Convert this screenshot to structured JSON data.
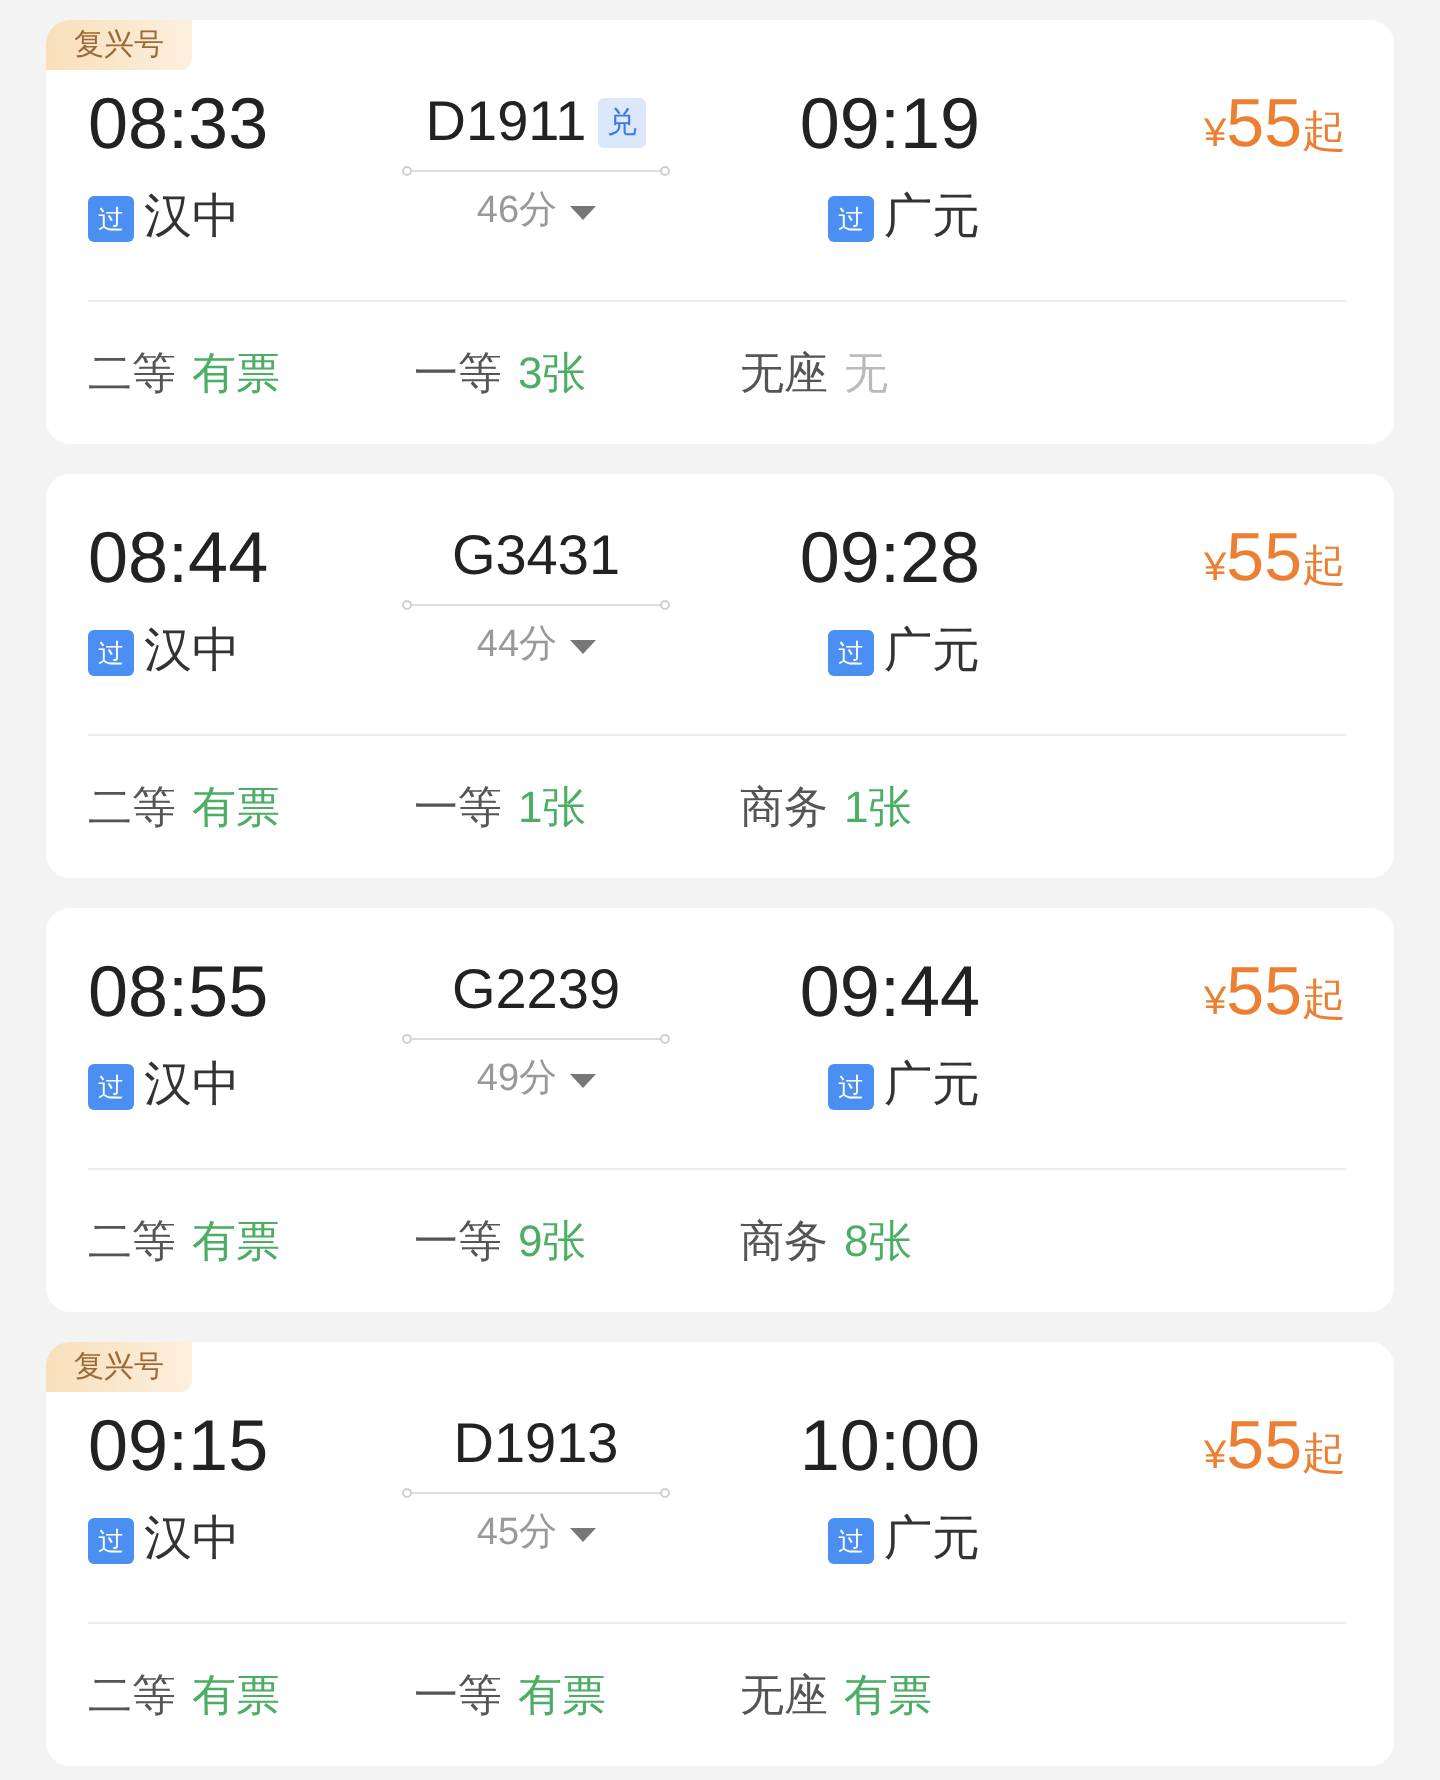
{
  "trains": [
    {
      "badge": "复兴号",
      "depart_time": "08:33",
      "depart_tag": "过",
      "depart_station": "汉中",
      "train_no": "D1911",
      "train_tag": "兑",
      "duration": "46分",
      "arrive_time": "09:19",
      "arrive_tag": "过",
      "arrive_station": "广元",
      "price_symbol": "¥",
      "price": "55",
      "price_suffix": "起",
      "seats": [
        {
          "class": "二等",
          "availability": "有票",
          "available": true
        },
        {
          "class": "一等",
          "availability": "3张",
          "available": true
        },
        {
          "class": "无座",
          "availability": "无",
          "available": false
        }
      ]
    },
    {
      "depart_time": "08:44",
      "depart_tag": "过",
      "depart_station": "汉中",
      "train_no": "G3431",
      "duration": "44分",
      "arrive_time": "09:28",
      "arrive_tag": "过",
      "arrive_station": "广元",
      "price_symbol": "¥",
      "price": "55",
      "price_suffix": "起",
      "seats": [
        {
          "class": "二等",
          "availability": "有票",
          "available": true
        },
        {
          "class": "一等",
          "availability": "1张",
          "available": true
        },
        {
          "class": "商务",
          "availability": "1张",
          "available": true
        }
      ]
    },
    {
      "depart_time": "08:55",
      "depart_tag": "过",
      "depart_station": "汉中",
      "train_no": "G2239",
      "duration": "49分",
      "arrive_time": "09:44",
      "arrive_tag": "过",
      "arrive_station": "广元",
      "price_symbol": "¥",
      "price": "55",
      "price_suffix": "起",
      "seats": [
        {
          "class": "二等",
          "availability": "有票",
          "available": true
        },
        {
          "class": "一等",
          "availability": "9张",
          "available": true
        },
        {
          "class": "商务",
          "availability": "8张",
          "available": true
        }
      ]
    },
    {
      "badge": "复兴号",
      "depart_time": "09:15",
      "depart_tag": "过",
      "depart_station": "汉中",
      "train_no": "D1913",
      "duration": "45分",
      "arrive_time": "10:00",
      "arrive_tag": "过",
      "arrive_station": "广元",
      "price_symbol": "¥",
      "price": "55",
      "price_suffix": "起",
      "seats": [
        {
          "class": "二等",
          "availability": "有票",
          "available": true
        },
        {
          "class": "一等",
          "availability": "有票",
          "available": true
        },
        {
          "class": "无座",
          "availability": "有票",
          "available": true
        }
      ]
    }
  ]
}
